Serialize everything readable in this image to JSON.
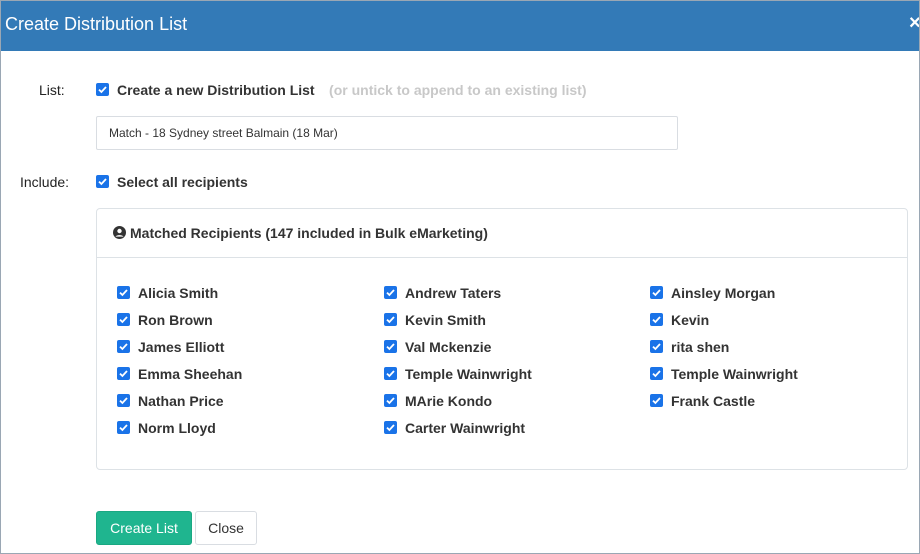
{
  "dialog": {
    "title": "Create Distribution List",
    "close_glyph": "×"
  },
  "list_row": {
    "label": "List:",
    "create_new_label": "Create a new Distribution List",
    "create_new_checked": true,
    "hint": "(or untick to append to an existing list)",
    "list_name_value": "Match - 18 Sydney street Balmain (18 Mar)"
  },
  "include_row": {
    "label": "Include:",
    "select_all_label": "Select all recipients",
    "select_all_checked": true
  },
  "recipients_panel": {
    "icon": "user-circle-icon",
    "title": "Matched Recipients (147 included in Bulk eMarketing)",
    "columns": [
      [
        "Alicia Smith",
        "Ron Brown",
        "James Elliott",
        "Emma Sheehan",
        "Nathan Price",
        "Norm Lloyd"
      ],
      [
        "Andrew Taters",
        "Kevin Smith",
        "Val Mckenzie",
        "Temple Wainwright",
        "MArie Kondo",
        "Carter Wainwright"
      ],
      [
        "Ainsley Morgan",
        "Kevin",
        "rita shen",
        "Temple Wainwright",
        "Frank Castle"
      ]
    ]
  },
  "buttons": {
    "create_label": "Create List",
    "close_label": "Close"
  },
  "colors": {
    "header": "#337ab7",
    "checkbox": "#1a73e8",
    "primary_button": "#1fb58f"
  }
}
